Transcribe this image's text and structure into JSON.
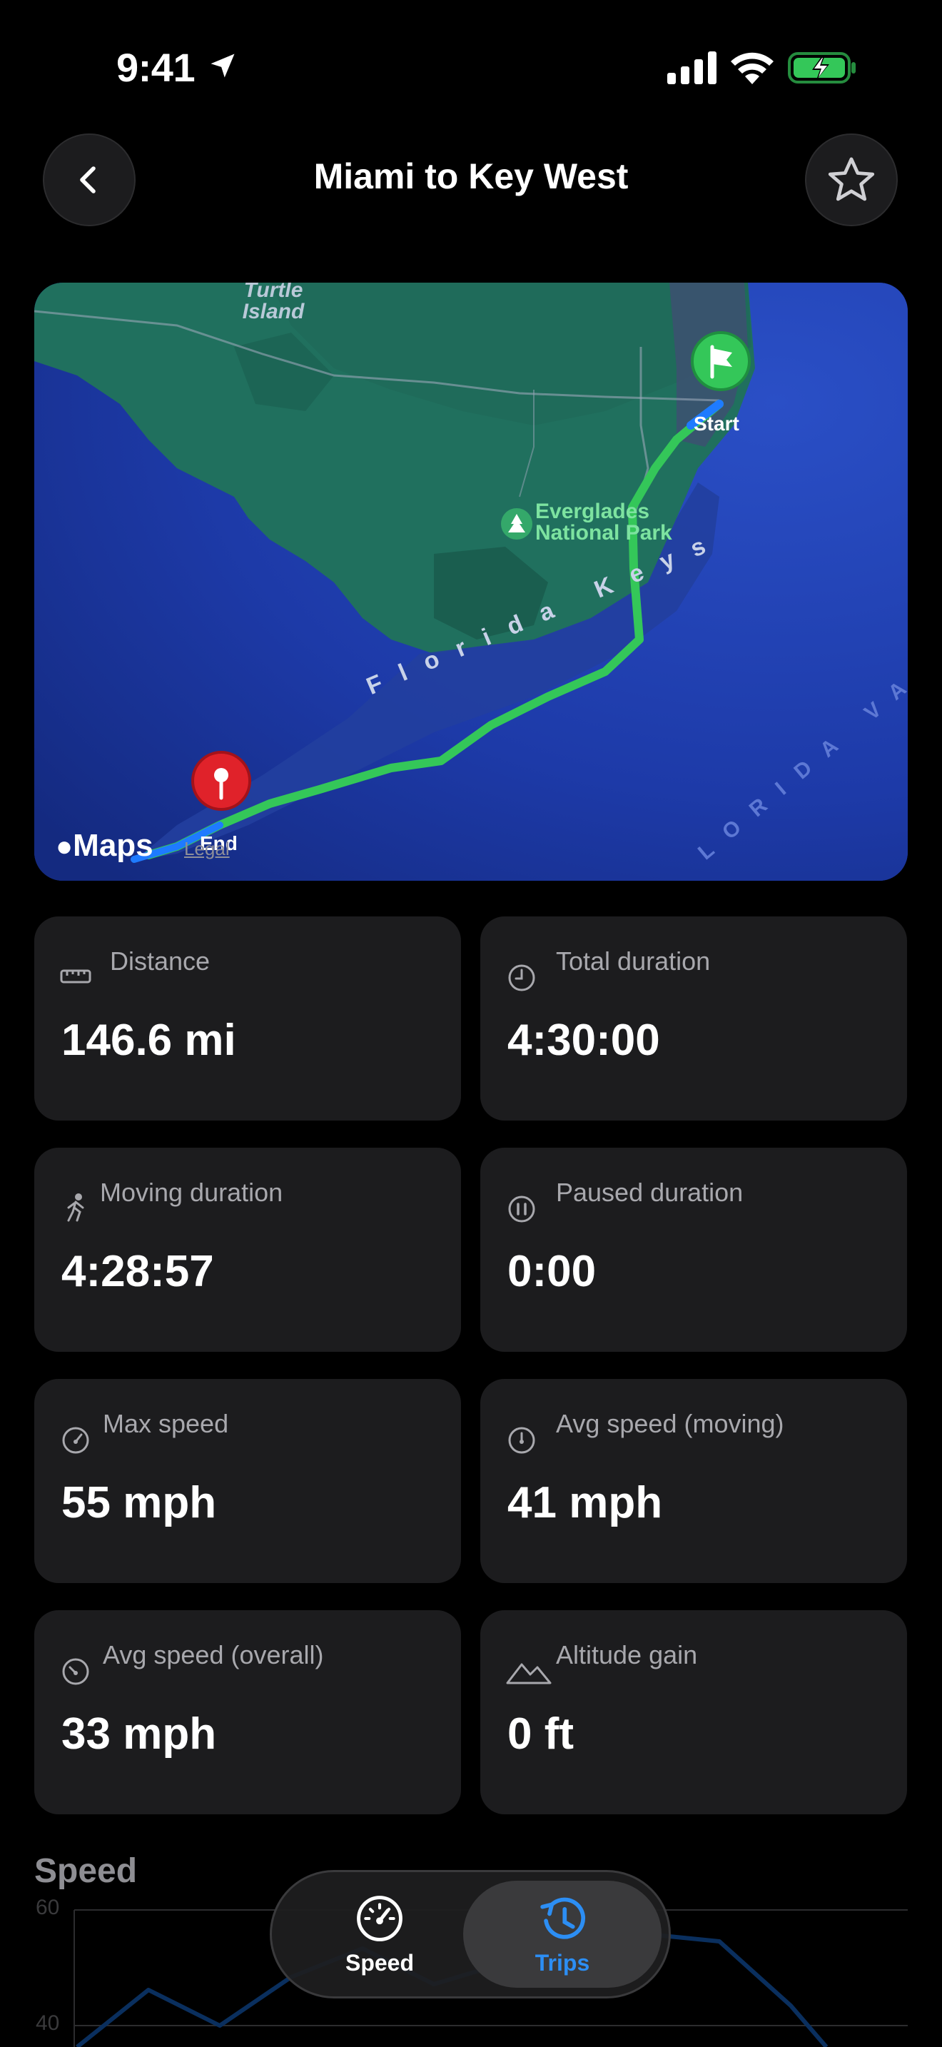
{
  "status_bar": {
    "time": "9:41"
  },
  "nav": {
    "title": "Miami to Key West"
  },
  "map": {
    "labels": {
      "turtle_island": "Turtle Island",
      "everglades": "Everglades National Park",
      "florida_keys": "Florida Keys",
      "florida_valley": "LORIDA VALL",
      "start": "Start",
      "end": "End"
    },
    "maps_logo": "Maps",
    "legal": "Legal",
    "route_color": "#34c759",
    "route_end_color": "#1e7bff"
  },
  "stats": [
    {
      "label": "Distance",
      "value": "146.6 mi",
      "icon": "ruler-icon"
    },
    {
      "label": "Total duration",
      "value": "4:30:00",
      "icon": "clock-icon"
    },
    {
      "label": "Moving duration",
      "value": "4:28:57",
      "icon": "walking-figure-icon"
    },
    {
      "label": "Paused duration",
      "value": "0:00",
      "icon": "pause-circle-icon"
    },
    {
      "label": "Max speed",
      "value": "55 mph",
      "icon": "speedometer-icon"
    },
    {
      "label": "Avg speed (moving)",
      "value": "41 mph",
      "icon": "speedometer-icon"
    },
    {
      "label": "Avg speed (overall)",
      "value": "33 mph",
      "icon": "speedometer-icon"
    },
    {
      "label": "Altitude gain",
      "value": "0 ft",
      "icon": "mountains-icon"
    }
  ],
  "speed_chart": {
    "title": "Speed",
    "y_ticks": [
      "60",
      "40"
    ]
  },
  "tabbar": {
    "tabs": [
      {
        "label": "Speed",
        "icon": "speedometer-icon",
        "selected": false
      },
      {
        "label": "Trips",
        "icon": "history-clock-icon",
        "selected": true
      }
    ],
    "accent": "#2c8ef4"
  }
}
